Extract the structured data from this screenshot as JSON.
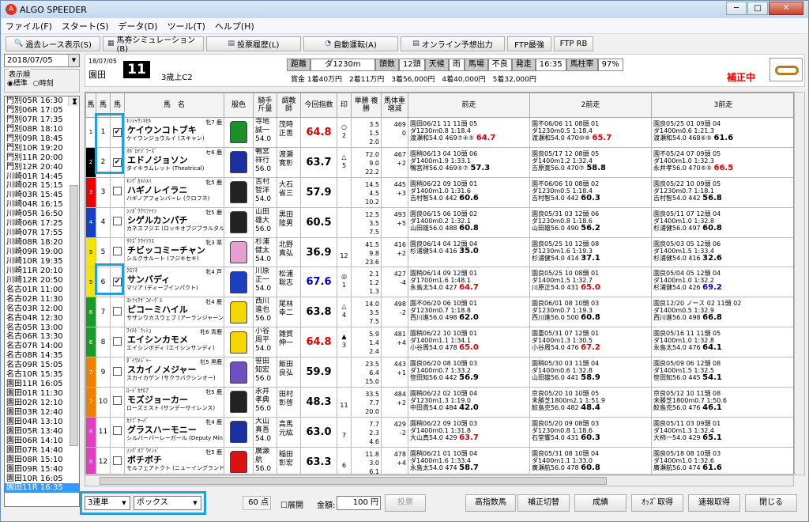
{
  "window": {
    "title": "ALGO SPEEDER",
    "min": "─",
    "max": "□",
    "close": "✕"
  },
  "menu": [
    "ファイル(F)",
    "スタート(S)",
    "データ(D)",
    "ツール(T)",
    "ヘルプ(H)"
  ],
  "toolbar": [
    "過去レース表示(S)",
    "馬券シミュレーション(B)",
    "投票履歴(L)",
    "自動運転(A)",
    "オンライン予想出力",
    "FTP最強",
    "FTP RB"
  ],
  "left": {
    "date": "2018/07/05",
    "order_label": "表示順",
    "radio1": "標準",
    "radio2": "時刻",
    "races": [
      "門別05R 16:30",
      "門別06R 17:05",
      "門別07R 17:35",
      "門別08R 18:10",
      "門別09R 18:45",
      "門別10R 19:20",
      "門別11R 20:00",
      "門別12R 20:40",
      "川崎01R 14:45",
      "川崎02R 15:15",
      "川崎03R 15:45",
      "川崎04R 16:15",
      "川崎05R 16:50",
      "川崎06R 17:25",
      "川崎07R 17:55",
      "川崎08R 18:20",
      "川崎09R 19:00",
      "川崎10R 19:35",
      "川崎11R 20:10",
      "川崎12R 20:50",
      "名古01R 11:00",
      "名古02R 11:30",
      "名古03R 12:00",
      "名古04R 12:30",
      "名古05R 13:00",
      "名古06R 13:30",
      "名古07R 14:00",
      "名古08R 14:35",
      "名古09R 15:05",
      "名古10R 15:35",
      "園田11R 16:05",
      "園田01R 11:30",
      "園田02R 12:10",
      "園田03R 12:40",
      "園田04R 13:10",
      "園田05R 13:40",
      "園田06R 14:10",
      "園田07R 14:40",
      "園田08R 15:10",
      "園田09R 15:40",
      "園田10R 16:05",
      "園田11R 16:35"
    ]
  },
  "race": {
    "date": "18/07/05",
    "venue": "園田",
    "no": "11",
    "cls": "3歳上C2",
    "info": [
      "距離",
      "ダ1230m",
      "頭数",
      "12頭",
      "天候",
      "雨",
      "馬場",
      "不良",
      "発走",
      "16:35",
      "馬柱率",
      "97%"
    ],
    "prize": "賞金 1着40万円　2着11万円　3着56,000円　4着40,000円　5着32,000円",
    "hosei": "補正中"
  },
  "headers": [
    "馬",
    "馬",
    "馬　名",
    "服色",
    "騎手\n斤量",
    "調教\n師",
    "今回指数",
    "印",
    "単勝\n複勝",
    "馬体重\n増減",
    "前走",
    "2前走",
    "3前走"
  ],
  "horses": [
    {
      "w": "1",
      "n": "1",
      "c": "#fff",
      "chk": true,
      "sire": "ｷﾝｼｬｻﾉｷｾｷ",
      "name": "ケイウンコトブキ",
      "dam": "ケイウンジョウルイ (スキャン)",
      "sex": "牝7 鹿",
      "jk": "寺地\n誠一\n54.0",
      "tr": "茂時\n正善",
      "sc": "64.8",
      "scc": "red",
      "mk": "○\n2",
      "odd": "3.5\n1.5\n2.0",
      "wt": "469\n0",
      "p1": "園田06/21 11 11頭 05\nダ1230m0.8 1:18.4\n渡瀬和54.0 469⑦④⑤ 64.7",
      "p1c": "red",
      "p2": "園不06/06 11 08頭 01\nダ1230m0.5 1:18.4\n渡瀬和54.0 470⑩⑨ 65.7",
      "p2c": "red",
      "p3": "園良05/25 01 09頭 04\nダ1400m0.6 1:21.3\n渡瀬和54.0 468⑥⑤ 61.6",
      "p3c": "blk",
      "silk": "#1a8f2a"
    },
    {
      "w": "2",
      "n": "2",
      "c": "#000",
      "chk": true,
      "sire": "ｵﾎﾞﾛｲﾂﾞﾗｰｽﾞ",
      "name": "エドノジョソン",
      "dam": "タイキラムレット (Theatrical)",
      "sex": "セ6 鹿",
      "jk": "鴨宮\n祥行\n56.0",
      "tr": "渡瀬\n寛彰",
      "sc": "63.7",
      "scc": "blk",
      "mk": "△\n5",
      "odd": "72.0\n9.0\n22.2",
      "wt": "467\n+2",
      "p1": "園稍06/13 04 10頭 06\nダ1400m1.9 1:33.1\n鴨宮祥56.0 469⑤⑦ 57.3",
      "p1c": "blk",
      "p2": "園良05/17 12 08頭 05\nダ1400m1.2 1:32.4\n吉原寛56.0 470⑦ 58.8",
      "p2c": "blk",
      "p3": "園不05/24 07 09頭 05\nダ1400m1.0 1:32.3\n永井孝56.0 470⑤⑤ 66.5",
      "p3c": "red",
      "silk": "#1b2fa0"
    },
    {
      "w": "3",
      "n": "3",
      "c": "#e00",
      "chk": false,
      "sire": "ｷﾝｸﾞｶﾒﾊﾒﾊ",
      "name": "ハギノレイラニ",
      "dam": "ハギノアフォンバーレ (クロフネ)",
      "sex": "牝5 鹿",
      "jk": "吉村\n智洋\n54.0",
      "tr": "大石\n省三",
      "sc": "57.9",
      "scc": "blk",
      "mk": "\n",
      "odd": "14.5\n4.5\n10.2",
      "wt": "445\n+3",
      "p1": "園稍06/22 09 10頭 01\nダ1400m1.0 1:31.6\n吉村智54.0 442 60.6",
      "p1c": "blk",
      "p2": "園不06/06 10 08頭 02\nダ1230m0.5 1:18.4\n吉村智54.0 442 60.3",
      "p2c": "blk",
      "p3": "園良05/22 10 09頭 05\nダ1230m0.7 1:18.1\n吉村智54.0 442 56.8",
      "p3c": "blk",
      "silk": "#222"
    },
    {
      "w": "4",
      "n": "4",
      "c": "#1540c8",
      "chk": false,
      "sire": "ｼﾝｶﾞｸｸﾘﾌｧｲﾝ",
      "name": "シゲルカンパチ",
      "dam": "カネスフジエ (ロッキオブジブラルタル)",
      "sex": "牡5 鹿",
      "jk": "山田\n雄大\n56.0",
      "tr": "黒田\n陸男",
      "sc": "60.5",
      "scc": "blk",
      "mk": "\n",
      "odd": "12.5\n3.5\n7.5",
      "wt": "493\n+5",
      "p1": "園良06/15 06 10頭 02\nダ1400m0.2 1:32.1\n山田雄56.0 488 60.8",
      "p1c": "blk",
      "p2": "園良05/31 03 12頭 06\nダ1230m0.8 1:18.6\n山田雄56.0 490 56.2",
      "p2c": "blk",
      "p3": "園良05/11 07 12頭 04\nダ1400m1.0 1:32.8\n杉浦健56.0 497 60.8",
      "p3c": "blk",
      "silk": "#222"
    },
    {
      "w": "5",
      "n": "5",
      "c": "#f5e400",
      "chk": false,
      "sire": "ｻｸｽﾞｸｳｲﾂﾗｽ",
      "name": "チビッコミーチャン",
      "dam": "シルクサルート (フジキセキ)",
      "sex": "牝3 栗",
      "jk": "杉浦\n健太\n54.0",
      "tr": "北野\n真弘",
      "sc": "36.9",
      "scc": "blk",
      "mk": "\n12",
      "odd": "41.5\n9.8\n23.6",
      "wt": "416\n+2",
      "p1": "園良06/14 04 12頭 04\n杉浦健54.0 416 35.0",
      "p1c": "blk",
      "p2": "園良05/25 10 12頭 08\nダ1230m1.6 1:19.3\n杉浦健54.0 414 37.1",
      "p2c": "blk",
      "p3": "園良05/03 05 12頭 06\nダ1400m1.5 1:33.4\n杉浦健54.0 416 32.6",
      "p3c": "blk",
      "silk": "#e3a0d0"
    },
    {
      "w": "5",
      "n": "6",
      "c": "#f5e400",
      "chk": true,
      "sire": "ｸﾛﾌﾈ",
      "name": "サンバディ",
      "dam": "マリア (ディープインパクト)",
      "sex": "牝4 芦",
      "jk": "川原\n正一\n54.0",
      "tr": "松浦\n聡志",
      "sc": "67.6",
      "scc": "blu",
      "mk": "◎\n1",
      "odd": "2.1\n1.2\n1.3",
      "wt": "427\n-4",
      "p1": "園稍06/14 09 12頭 01\nダ1700m1.6 1:48.1\n永島太54.0 427 64.7",
      "p1c": "red",
      "p2": "園良05/25 10 08頭 01\nダ1400m1.5 1:32.7\n川原正54.0 431 65.0",
      "p2c": "red",
      "p3": "園良05/04 05 12頭 04\nダ1400m1.0 1:32.2\n杉浦健54.0 426 69.2",
      "p3c": "blu",
      "silk": "#1b3fc0"
    },
    {
      "w": "6",
      "n": "7",
      "c": "#1a9a2a",
      "chk": false,
      "sire": "ｽﾄﾗｲｸｻﾞｺｲｰｸﾞﾙ",
      "name": "ピコーミハイル",
      "dam": "サザンウカスウェブ (アーランジャーン)",
      "sex": "牡4 鹿",
      "jk": "西川\n進也\n56.0",
      "tr": "尾林\n幸二",
      "sc": "63.8",
      "scc": "blk",
      "mk": "△\n4",
      "odd": "14.0\n3.5\n7.5",
      "wt": "498\n-2",
      "p1": "園不06/20 06 10頭 01\nダ1230m0.7 1:18.8\n西川進56.0 498 62.0",
      "p1c": "blk",
      "p2": "園良06/01 08 10頭 03\nダ1230m0.7 1:19.3\n西川進56.0 500 60.8",
      "p2c": "blk",
      "p3": "園良12/20 ノース 02 11頭 02\nダ1400m0.5 1:32.9\n西川進56.0 498 66.8",
      "p3c": "blk",
      "silk": "#f5d700"
    },
    {
      "w": "6",
      "n": "8",
      "c": "#1a9a2a",
      "chk": false,
      "sire": "ﾜｲﾙﾄﾞﾗｯｼｭ",
      "name": "エイシンカモメ",
      "dam": "エイシンボディ (エイシンサンディ)",
      "sex": "牝6 青鹿",
      "jk": "小谷\n周平\n54.0",
      "tr": "雑賀\n伸一",
      "sc": "64.8",
      "scc": "red",
      "mk": "▲\n3",
      "odd": "5.9\n1.4\n2.4",
      "wt": "481\n+4",
      "p1": "園稍06/22 10 10頭 01\nダ1400m1.1 1:34.1\n小谷周54.0 478 65.0",
      "p1c": "red",
      "p2": "園重05/31 07 12頭 01\nダ1400m1.3 1:30.5\n小谷周54.0 476 67.2",
      "p2c": "red",
      "p3": "園良05/16 11 11頭 05\nダ1400m1.0 1:32.8\n永島太54.0 476 64.1",
      "p3c": "blk",
      "silk": "#f5d700"
    },
    {
      "w": "7",
      "n": "9",
      "c": "#f08000",
      "chk": false,
      "sire": "ﾀﾞｲﾜﾒｼﾞｬｰ",
      "name": "スカイノメジャー",
      "dam": "スカイカゲン (サクラバクシンオー)",
      "sex": "牡5 黒鹿",
      "jk": "笹田\n知宏\n56.0",
      "tr": "飯田\n良弘",
      "sc": "59.9",
      "scc": "blk",
      "mk": "\n",
      "odd": "23.5\n6.4\n15.0",
      "wt": "443\n+1",
      "p1": "園良06/20 08 10頭 03\nダ1400m0.7 1:33.2\n笹田知56.0 442 56.9",
      "p1c": "blk",
      "p2": "園稍05/30 03 11頭 04\nダ1400m0.6 1:32.8\n山田雄56.0 441 58.9",
      "p2c": "blk",
      "p3": "園良05/09 06 12頭 08\nダ1400m1.5 1:32.5\n笹田知56.0 445 54.1",
      "p3c": "blk",
      "silk": "#7050c0"
    },
    {
      "w": "7",
      "n": "10",
      "c": "#f08000",
      "chk": false,
      "sire": "ﾛｰﾄﾞｶﾅﾛｱ",
      "name": "モズジョーカー",
      "dam": "ローズミスト (サンデーサイレンス)",
      "sex": "牡5 鹿",
      "jk": "永井\n孝典\n56.0",
      "tr": "田村\n彰啓",
      "sc": "48.3",
      "scc": "blk",
      "mk": "\n11",
      "odd": "33.5\n7.7\n20.0",
      "wt": "484\n+2",
      "p1": "園稍06/22 02 10頭 04\nダ1230m1.3 1:19.0\n中田貴54.0 484 42.0",
      "p1c": "blk",
      "p2": "京良05/20 10 10頭 05\n未勝芝1800m2.1 1:51.9\n鮫島克56.0 482 48.4",
      "p2c": "blk",
      "p3": "京良05/12 10 11頭 08\n未勝芝1800m0.7 1:50.6\n鮫島克56.0 476 46.1",
      "p3c": "blk",
      "silk": "#222"
    },
    {
      "w": "8",
      "n": "11",
      "c": "#e040c0",
      "chk": false,
      "sire": "ｶﾘﾌﾞﾔｰﾊﾞ",
      "name": "グラスハーモニー",
      "dam": "シルバーバーレーガール (Deputy Min",
      "sex": "牝4 鹿",
      "jk": "大山\n真吾\n54.0",
      "tr": "高馬\n元紘",
      "sc": "63.0",
      "scc": "blk",
      "mk": "\n7",
      "odd": "7.7\n2.3\n4.6",
      "wt": "429\n-2",
      "p1": "園稍06/22 09 10頭 03\nダ1400m0.1 1:31.8\n大山真54.0 429 63.7",
      "p1c": "red",
      "p2": "園良05/20 09 08頭 03\nダ1230m0.8 1:18.6\n石堂響54.0 431 60.3",
      "p2c": "blk",
      "p3": "園良05/11 03 09頭 01\nダ1400m1.3 1:32.4\n大柿一54.0 429 65.1",
      "p3c": "blk",
      "silk": "#1b2fa0"
    },
    {
      "w": "8",
      "n": "12",
      "c": "#e040c0",
      "chk": false,
      "sire": "ｿﾝｸﾞｵﾌﾞｳｲﾝﾄﾞ",
      "name": "ボチボチ",
      "dam": "モルフェアトクト (ニューイングランド)",
      "sex": "牡5 鹿",
      "jk": "廣瀬\n航\n56.0",
      "tr": "稲田\n彰宏",
      "sc": "63.3",
      "scc": "blk",
      "mk": "\n6",
      "odd": "11.8\n3.0\n6.1",
      "wt": "478\n+4",
      "p1": "園稍06/21 01 10頭 04\nダ1400m1.6 1:33.4\n永島太54.0 474 58.7",
      "p1c": "blk",
      "p2": "園良05/31 08 10頭 04\nダ1400m1.1 1:33.0\n廣瀬航56.0 478 60.8",
      "p2c": "blk",
      "p3": "園良05/18 08 10頭 03\nダ1400m1.0 1:32.6\n廣瀬航56.0 474 61.6",
      "p3c": "blk",
      "silk": "#d11"
    }
  ],
  "bottom": {
    "bet": "3連単",
    "mode": "ボックス",
    "points": "60 点",
    "expand": "展開",
    "amount_label": "金額:",
    "amount": "100 円",
    "vote": "投票",
    "btns": [
      "高指数馬",
      "補正切替",
      "成績",
      "ｵｯｽﾞ取得",
      "速報取得",
      "閉じる"
    ]
  }
}
